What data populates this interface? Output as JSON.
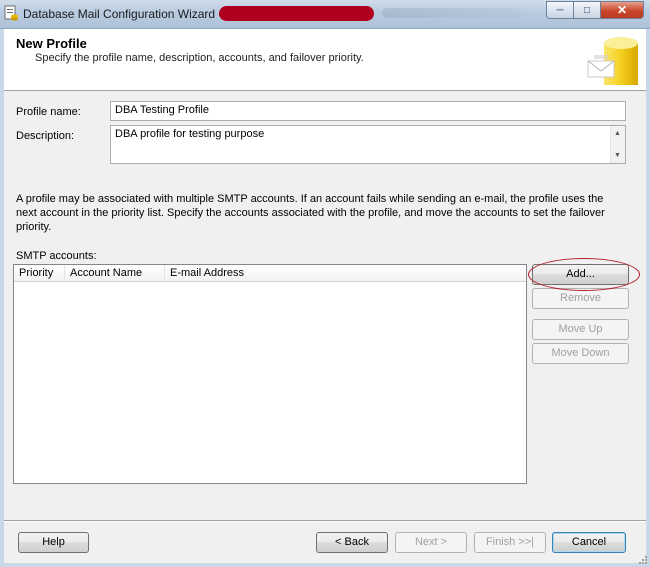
{
  "window": {
    "title": "Database Mail Configuration Wizard -",
    "minimize_glyph": "─",
    "maximize_glyph": "□",
    "close_glyph": "✕"
  },
  "header": {
    "title": "New Profile",
    "subtitle": "Specify the profile name, description, accounts, and failover priority."
  },
  "form": {
    "profile_name_label": "Profile name:",
    "profile_name_value": "DBA Testing Profile",
    "description_label": "Description:",
    "description_value": "DBA profile for testing purpose"
  },
  "info_text": "A profile may be associated with multiple SMTP accounts. If an account fails while sending an e-mail, the profile uses the next account in the priority list. Specify the accounts associated with the profile, and move the accounts to set the failover priority.",
  "smtp": {
    "label": "SMTP accounts:",
    "columns": [
      "Priority",
      "Account Name",
      "E-mail Address"
    ],
    "rows": []
  },
  "side_buttons": {
    "add": "Add...",
    "remove": "Remove",
    "move_up": "Move Up",
    "move_down": "Move Down"
  },
  "footer": {
    "help": "Help",
    "back": "< Back",
    "next": "Next >",
    "finish": "Finish >>|",
    "cancel": "Cancel"
  },
  "icons": {
    "app": "wizard-app-icon",
    "header_logo": "database-mail-logo-icon",
    "scroll_up": "scroll-up-arrow-icon",
    "scroll_down": "scroll-down-arrow-icon",
    "size_grip": "size-grip-icon"
  },
  "colors": {
    "annotation_circle": "#b0202a",
    "redaction": "#b1001f",
    "title_bar": "#b9cbe0"
  }
}
